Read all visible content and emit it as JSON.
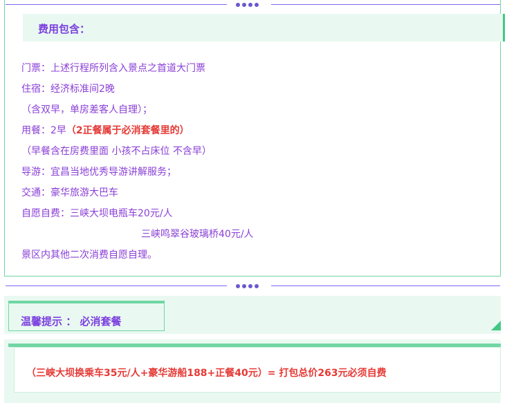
{
  "fee_section": {
    "title": "费用包含：",
    "items": [
      {
        "label": "门票：上述行程所列含入景点之首道大门票"
      },
      {
        "label": "住宿：经济标准间2晚"
      },
      {
        "label": "（含双早，单房差客人自理）；"
      },
      {
        "label": "用餐：2早",
        "note": "（2正餐属于必消套餐里的）"
      },
      {
        "label": "（早餐含在房费里面 小孩不占床位 不含早）"
      },
      {
        "label": "导游：宜昌当地优秀导游讲解服务；"
      },
      {
        "label": "交通：豪华旅游大巴车"
      },
      {
        "label": "自愿自费：三峡大坝电瓶车20元/人"
      },
      {
        "label": "三峡鸣翠谷玻璃桥40元/人"
      },
      {
        "label": "景区内其他二次消费自愿自理。"
      }
    ]
  },
  "tips_section": {
    "label": "温馨提示 ：  必消套餐"
  },
  "package_section": {
    "text": "（三峡大坝换乘车35元/人+豪华游船188+正餐40元）= 打包总价263元必须自费"
  },
  "colors": {
    "accent_purple": "#7b3fe0",
    "accent_green": "#43c785",
    "light_green": "#e9f9f1",
    "red": "#e53935"
  }
}
